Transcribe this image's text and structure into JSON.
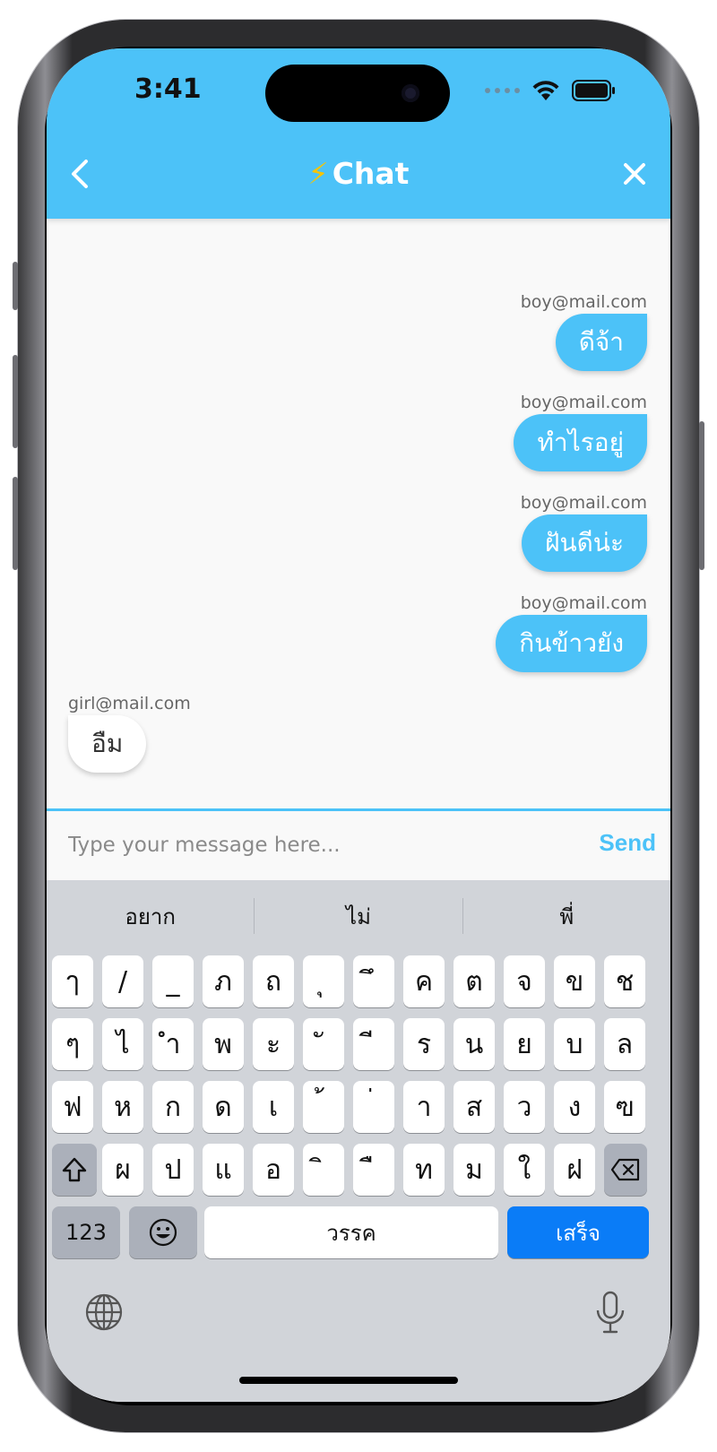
{
  "status": {
    "time": "3:41"
  },
  "header": {
    "title": "Chat",
    "title_icon": "lightning-icon",
    "back_icon": "chevron-left-icon",
    "close_icon": "close-icon",
    "color": "#4cc2f8"
  },
  "messages": [
    {
      "sender": "boy@mail.com",
      "text": "ดีจ้า",
      "mine": true
    },
    {
      "sender": "boy@mail.com",
      "text": "ทำไรอยู่",
      "mine": true
    },
    {
      "sender": "boy@mail.com",
      "text": "ฝันดีน่ะ",
      "mine": true
    },
    {
      "sender": "boy@mail.com",
      "text": "กินข้าวยัง",
      "mine": true
    },
    {
      "sender": "girl@mail.com",
      "text": "อืม",
      "mine": false
    }
  ],
  "input": {
    "placeholder": "Type your message here...",
    "value": "",
    "send_label": "Send"
  },
  "keyboard": {
    "suggestions": [
      "อยาก",
      "ไม่",
      "พี่"
    ],
    "row1": [
      "ๅ",
      "/",
      "_",
      "ภ",
      "ถ",
      "ุ",
      "ึ",
      "ค",
      "ต",
      "จ",
      "ข",
      "ช"
    ],
    "row2": [
      "ๆ",
      "ไ",
      "ำ",
      "พ",
      "ะ",
      "ั",
      "ี",
      "ร",
      "น",
      "ย",
      "บ",
      "ล"
    ],
    "row3": [
      "ฟ",
      "ห",
      "ก",
      "ด",
      "เ",
      "้",
      "่",
      "า",
      "ส",
      "ว",
      "ง",
      "ฃ"
    ],
    "row4": [
      "ผ",
      "ป",
      "แ",
      "อ",
      "ิ",
      "ื",
      "ท",
      "ม",
      "ใ",
      "ฝ"
    ],
    "numbers_label": "123",
    "space_label": "วรรค",
    "done_label": "เสร็จ"
  }
}
